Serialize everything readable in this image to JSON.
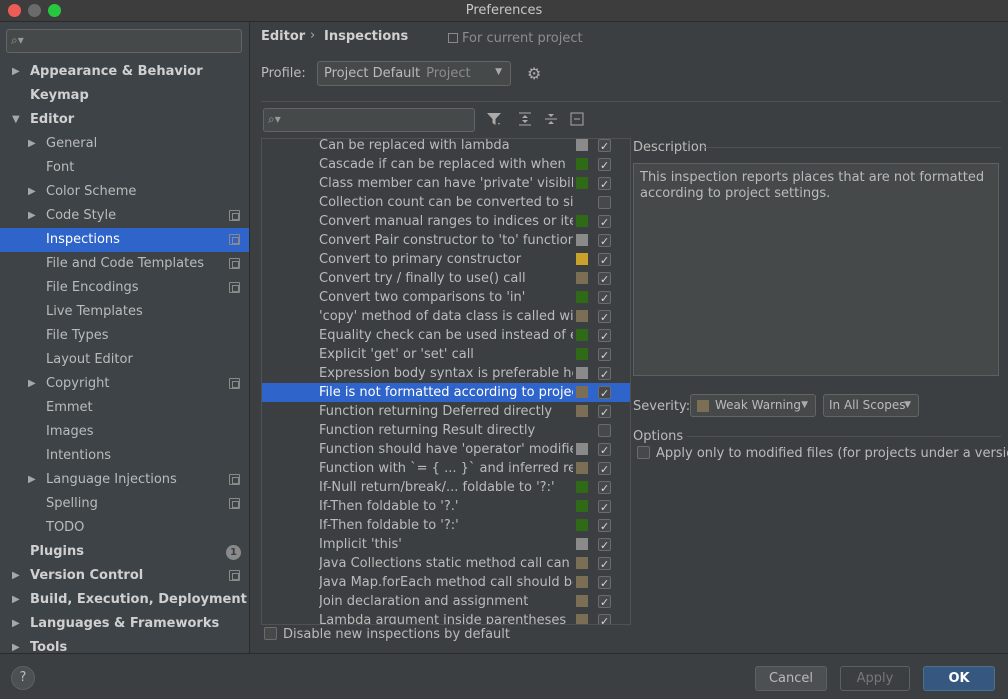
{
  "window": {
    "title": "Preferences"
  },
  "sidebar": {
    "search_placeholder": "",
    "items": [
      {
        "label": "Appearance & Behavior",
        "level": 0,
        "arrow": "right",
        "bold": true
      },
      {
        "label": "Keymap",
        "level": 0,
        "arrow": "",
        "bold": true
      },
      {
        "label": "Editor",
        "level": 0,
        "arrow": "down",
        "bold": true
      },
      {
        "label": "General",
        "level": 1,
        "arrow": "right"
      },
      {
        "label": "Font",
        "level": 1,
        "arrow": ""
      },
      {
        "label": "Color Scheme",
        "level": 1,
        "arrow": "right"
      },
      {
        "label": "Code Style",
        "level": 1,
        "arrow": "right",
        "project_icon": true
      },
      {
        "label": "Inspections",
        "level": 1,
        "arrow": "",
        "project_icon": true,
        "selected": true
      },
      {
        "label": "File and Code Templates",
        "level": 1,
        "arrow": "",
        "project_icon": true
      },
      {
        "label": "File Encodings",
        "level": 1,
        "arrow": "",
        "project_icon": true
      },
      {
        "label": "Live Templates",
        "level": 1,
        "arrow": ""
      },
      {
        "label": "File Types",
        "level": 1,
        "arrow": ""
      },
      {
        "label": "Layout Editor",
        "level": 1,
        "arrow": ""
      },
      {
        "label": "Copyright",
        "level": 1,
        "arrow": "right",
        "project_icon": true
      },
      {
        "label": "Emmet",
        "level": 1,
        "arrow": ""
      },
      {
        "label": "Images",
        "level": 1,
        "arrow": ""
      },
      {
        "label": "Intentions",
        "level": 1,
        "arrow": ""
      },
      {
        "label": "Language Injections",
        "level": 1,
        "arrow": "right",
        "project_icon": true
      },
      {
        "label": "Spelling",
        "level": 1,
        "arrow": "",
        "project_icon": true
      },
      {
        "label": "TODO",
        "level": 1,
        "arrow": ""
      },
      {
        "label": "Plugins",
        "level": 0,
        "arrow": "",
        "bold": true,
        "badge": "1"
      },
      {
        "label": "Version Control",
        "level": 0,
        "arrow": "right",
        "bold": true,
        "project_icon": true
      },
      {
        "label": "Build, Execution, Deployment",
        "level": 0,
        "arrow": "right",
        "bold": true
      },
      {
        "label": "Languages & Frameworks",
        "level": 0,
        "arrow": "right",
        "bold": true
      },
      {
        "label": "Tools",
        "level": 0,
        "arrow": "right",
        "bold": true
      }
    ]
  },
  "header": {
    "breadcrumb_1": "Editor",
    "breadcrumb_sep": "›",
    "breadcrumb_2": "Inspections",
    "for_current_project": "For current project"
  },
  "profile": {
    "label": "Profile:",
    "value": "Project Default",
    "sub": "Project"
  },
  "inspection_search_placeholder": "",
  "severity_colors": {
    "weak_warning": "#7a6f55",
    "warning": "#c8a22a",
    "server": "#2f6b17",
    "no_highlight": "#8a8a8a"
  },
  "inspections": [
    {
      "name": "Can be replaced with lambda",
      "sev": "#8a8a8a",
      "checked": true
    },
    {
      "name": "Cascade if can be replaced with when",
      "sev": "#2f6b17",
      "checked": true
    },
    {
      "name": "Class member can have 'private' visibility",
      "sev": "#2f6b17",
      "checked": true
    },
    {
      "name": "Collection count can be converted to size",
      "sev": "",
      "checked": false
    },
    {
      "name": "Convert manual ranges to indices or iteration",
      "sev": "#2f6b17",
      "checked": true
    },
    {
      "name": "Convert Pair constructor to 'to' function",
      "sev": "#8a8a8a",
      "checked": true
    },
    {
      "name": "Convert to primary constructor",
      "sev": "#c8a22a",
      "checked": true
    },
    {
      "name": "Convert try / finally to use() call",
      "sev": "#7a6f55",
      "checked": true
    },
    {
      "name": "Convert two comparisons to 'in'",
      "sev": "#2f6b17",
      "checked": true
    },
    {
      "name": "'copy' method of data class is called without",
      "sev": "#7a6f55",
      "checked": true
    },
    {
      "name": "Equality check can be used instead of elvis",
      "sev": "#2f6b17",
      "checked": true
    },
    {
      "name": "Explicit 'get' or 'set' call",
      "sev": "#2f6b17",
      "checked": true
    },
    {
      "name": "Expression body syntax is preferable here",
      "sev": "#8a8a8a",
      "checked": true
    },
    {
      "name": "File is not formatted according to project",
      "sev": "#7a6f55",
      "checked": true,
      "selected": true
    },
    {
      "name": "Function returning Deferred directly",
      "sev": "#7a6f55",
      "checked": true
    },
    {
      "name": "Function returning Result directly",
      "sev": "",
      "checked": false
    },
    {
      "name": "Function should have 'operator' modifier",
      "sev": "#8a8a8a",
      "checked": true
    },
    {
      "name": "Function with `= { ... }` and inferred return",
      "sev": "#7a6f55",
      "checked": true
    },
    {
      "name": "If-Null return/break/... foldable to '?:'",
      "sev": "#2f6b17",
      "checked": true
    },
    {
      "name": "If-Then foldable to '?.'",
      "sev": "#2f6b17",
      "checked": true
    },
    {
      "name": "If-Then foldable to '?:'",
      "sev": "#2f6b17",
      "checked": true
    },
    {
      "name": "Implicit 'this'",
      "sev": "#8a8a8a",
      "checked": true
    },
    {
      "name": "Java Collections static method call can be",
      "sev": "#7a6f55",
      "checked": true
    },
    {
      "name": "Java Map.forEach method call should be",
      "sev": "#7a6f55",
      "checked": true
    },
    {
      "name": "Join declaration and assignment",
      "sev": "#7a6f55",
      "checked": true
    },
    {
      "name": "Lambda argument inside parentheses",
      "sev": "#7a6f55",
      "checked": true
    }
  ],
  "disable_new": "Disable new inspections by default",
  "description": {
    "label": "Description",
    "text": "This inspection reports places that are not formatted according to project settings."
  },
  "severity": {
    "label": "Severity:",
    "value": "Weak Warning",
    "scope": "In All Scopes"
  },
  "options": {
    "label": "Options",
    "apply_only_modified": "Apply only to modified files (for projects under a version"
  },
  "footer": {
    "help": "?",
    "cancel": "Cancel",
    "apply": "Apply",
    "ok": "OK"
  }
}
